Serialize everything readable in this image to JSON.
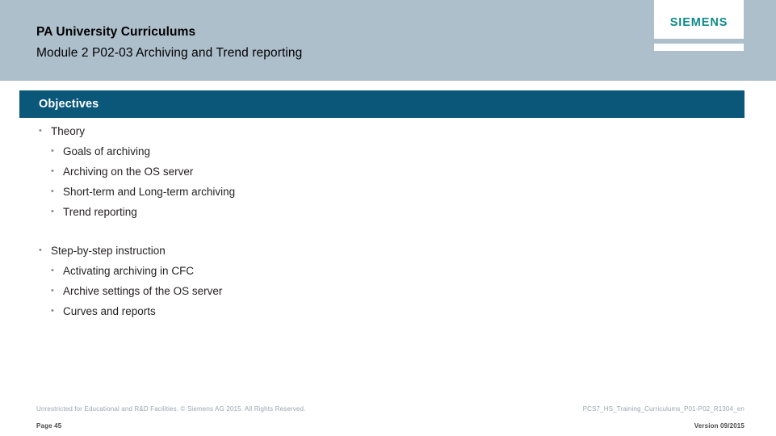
{
  "header": {
    "title": "PA University Curriculums",
    "subtitle": "Module 2 P02-03 Archiving and Trend reporting",
    "band_color": "#aebfcc"
  },
  "logo": {
    "wordmark": "SIEMENS",
    "color": "#0e8a8a"
  },
  "section": {
    "heading": "Objectives",
    "bar_color": "#0b5779",
    "text_color": "#ffffff"
  },
  "content": {
    "groups": [
      {
        "heading": "Theory",
        "items": [
          "Goals of archiving",
          "Archiving on the OS server",
          "Short-term and Long-term archiving",
          "Trend reporting"
        ]
      },
      {
        "heading": "Step-by-step instruction",
        "items": [
          "Activating archiving in CFC",
          "Archive settings of the OS server",
          "Curves and reports"
        ]
      }
    ]
  },
  "footer": {
    "copyright": "Unrestricted for Educational and R&D Facilities. © Siemens AG 2015. All Rights Reserved.",
    "page": "Page 45",
    "document_id": "PCS7_HS_Training_Curriculums_P01-P02_R1304_en",
    "version": "Version 09/2015"
  }
}
